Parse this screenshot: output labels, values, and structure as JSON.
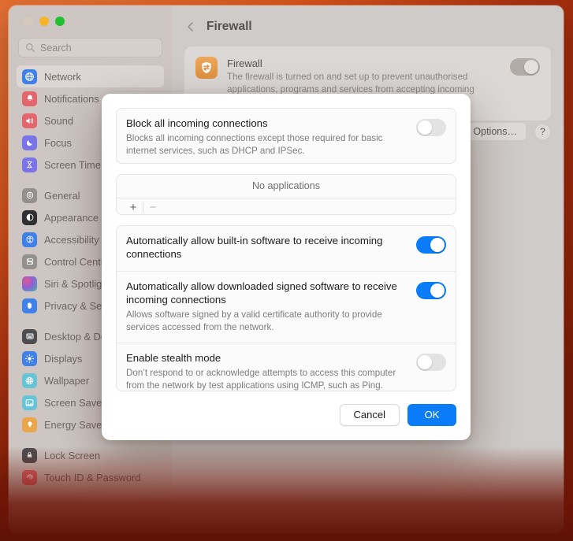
{
  "window": {
    "traffic_lights": [
      "close",
      "minimise",
      "maximise"
    ],
    "search": {
      "placeholder": "Search",
      "value": ""
    }
  },
  "sidebar": {
    "groups": [
      {
        "items": [
          {
            "label": "Network",
            "icon": "globe-icon",
            "color": "#3f81e8",
            "selected": true
          },
          {
            "label": "Notifications",
            "icon": "bell-icon",
            "color": "#e4656b",
            "selected": false
          },
          {
            "label": "Sound",
            "icon": "speaker-icon",
            "color": "#e4656b",
            "selected": false
          },
          {
            "label": "Focus",
            "icon": "moon-icon",
            "color": "#7b74e8",
            "selected": false
          },
          {
            "label": "Screen Time",
            "icon": "hourglass-icon",
            "color": "#7b74e8",
            "selected": false
          }
        ]
      },
      {
        "items": [
          {
            "label": "General",
            "icon": "gear-icon",
            "color": "#93908d",
            "selected": false
          },
          {
            "label": "Appearance",
            "icon": "contrast-icon",
            "color": "#2f2f31",
            "selected": false
          },
          {
            "label": "Accessibility",
            "icon": "accessibility-icon",
            "color": "#3f81e8",
            "selected": false
          },
          {
            "label": "Control Centre",
            "icon": "sliders-icon",
            "color": "#93908d",
            "selected": false
          },
          {
            "label": "Siri & Spotlight",
            "icon": "siri-icon",
            "color": "#c9569e",
            "selected": false
          },
          {
            "label": "Privacy & Security",
            "icon": "hand-icon",
            "color": "#3f81e8",
            "selected": false
          }
        ]
      },
      {
        "items": [
          {
            "label": "Desktop & Dock",
            "icon": "dock-icon",
            "color": "#4d4d50",
            "selected": false
          },
          {
            "label": "Displays",
            "icon": "brightness-icon",
            "color": "#3f81e8",
            "selected": false
          },
          {
            "label": "Wallpaper",
            "icon": "flower-icon",
            "color": "#67c4d8",
            "selected": false
          },
          {
            "label": "Screen Saver",
            "icon": "screensaver-icon",
            "color": "#67c4d8",
            "selected": false
          },
          {
            "label": "Energy Saver",
            "icon": "bulb-icon",
            "color": "#eaa64a",
            "selected": false
          }
        ]
      },
      {
        "items": [
          {
            "label": "Lock Screen",
            "icon": "lock-icon",
            "color": "#4d4d50",
            "selected": false
          },
          {
            "label": "Touch ID & Password",
            "icon": "fingerprint-icon",
            "color": "#e4656b",
            "selected": false
          }
        ]
      }
    ]
  },
  "detail": {
    "back_label": "Back",
    "title": "Firewall",
    "firewall_card": {
      "icon": "firewall-shield-icon",
      "name": "Firewall",
      "description": "The firewall is turned on and set up to prevent unauthorised applications, programs and services from accepting incoming connections.",
      "toggle_state": "on"
    },
    "options_label": "Options…",
    "help_label": "?"
  },
  "sheet": {
    "block_all": {
      "title": "Block all incoming connections",
      "subtitle": "Blocks all incoming connections except those required for basic internet services, such as DHCP and IPSec.",
      "toggle_state": "off"
    },
    "applications": {
      "empty_text": "No applications",
      "add_label": "+",
      "remove_label": "−",
      "items": []
    },
    "options": [
      {
        "title": "Automatically allow built-in software to receive incoming connections",
        "subtitle": "",
        "toggle_state": "on"
      },
      {
        "title": "Automatically allow downloaded signed software to receive incoming connections",
        "subtitle": "Allows software signed by a valid certificate authority to provide services accessed from the network.",
        "toggle_state": "on"
      },
      {
        "title": "Enable stealth mode",
        "subtitle": "Don’t respond to or acknowledge attempts to access this computer from the network by test applications using ICMP, such as Ping.",
        "toggle_state": "off"
      }
    ],
    "cancel_label": "Cancel",
    "ok_label": "OK"
  },
  "colors": {
    "accent_blue": "#0a7cf9",
    "toggle_off": "#e3e3e3",
    "firewall_orange": "#e09140",
    "wallpaper": "#d8561d"
  }
}
